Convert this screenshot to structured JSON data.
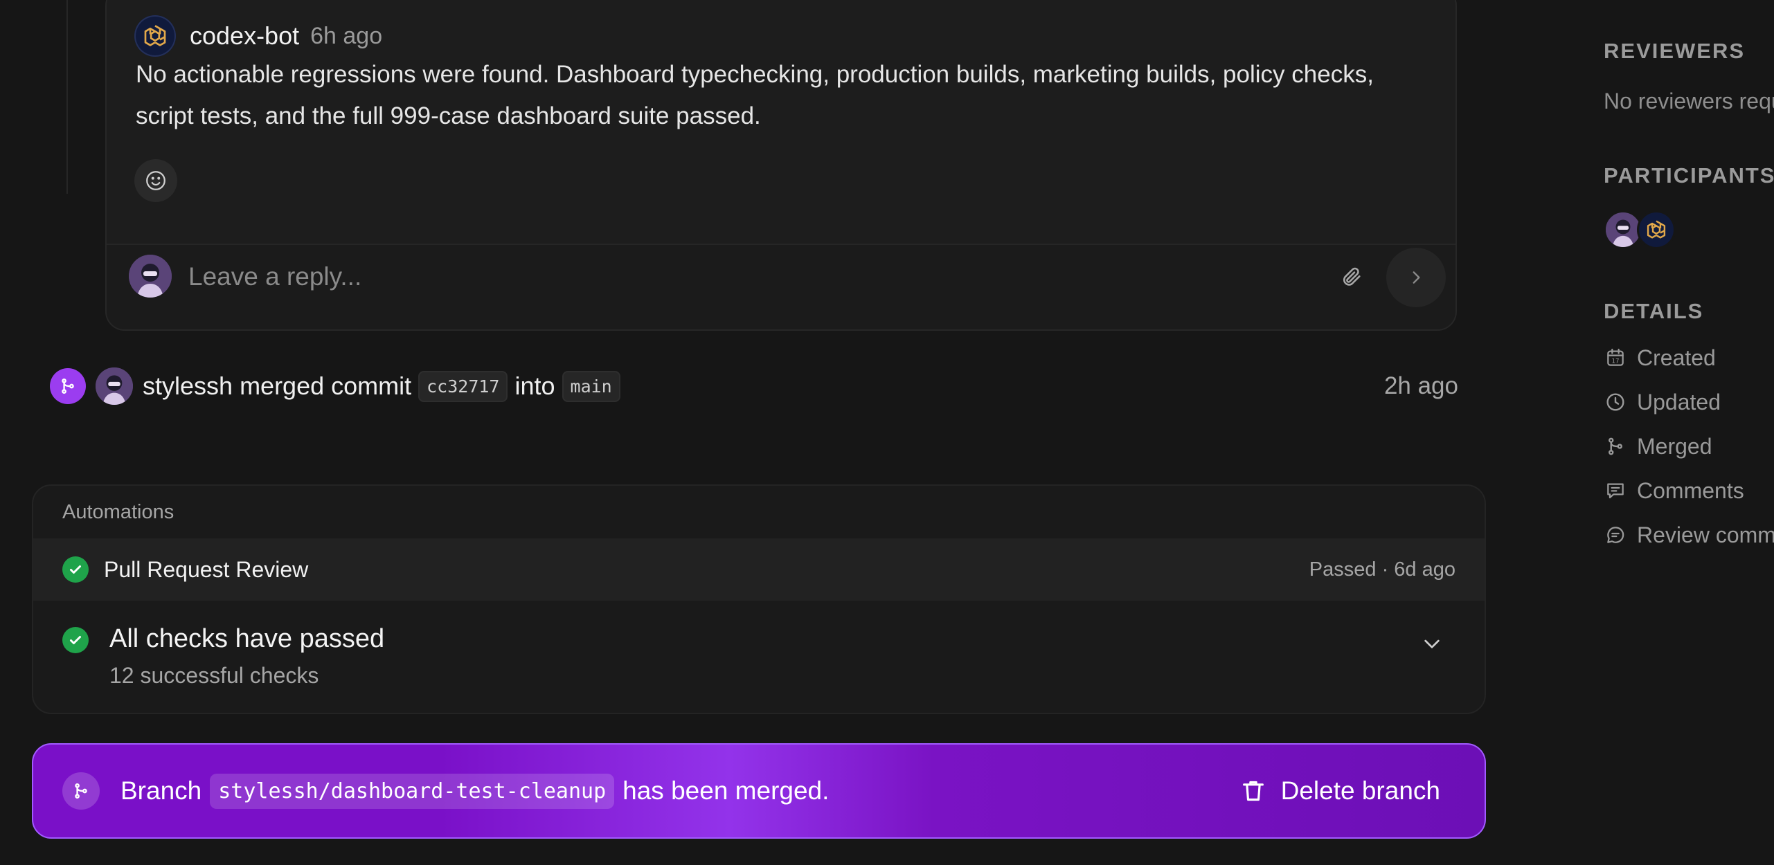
{
  "comment": {
    "author": "codex-bot",
    "time": "6h ago",
    "body": "No actionable regressions were found. Dashboard typechecking, production builds, marketing builds, policy checks, script tests, and the full 999-case dashboard suite passed.",
    "reply_placeholder": "Leave a reply..."
  },
  "merge_event": {
    "user": "stylessh",
    "verb": "merged commit",
    "commit": "cc32717",
    "into": "into",
    "branch": "main",
    "time": "2h ago"
  },
  "automations": {
    "title": "Automations",
    "review": {
      "label": "Pull Request Review",
      "status": "Passed · 6d ago"
    },
    "checks": {
      "title": "All checks have passed",
      "subtitle": "12 successful checks"
    }
  },
  "merged_banner": {
    "prefix": "Branch",
    "branch": "stylessh/dashboard-test-cleanup",
    "suffix": "has been merged.",
    "delete_label": "Delete branch"
  },
  "sidebar": {
    "reviewers_heading": "REVIEWERS",
    "reviewers_note": "No reviewers requested",
    "participants_heading": "PARTICIPANTS",
    "details_heading": "DETAILS",
    "details": [
      {
        "icon": "calendar-icon",
        "label": "Created"
      },
      {
        "icon": "clock-icon",
        "label": "Updated"
      },
      {
        "icon": "merge-icon",
        "label": "Merged"
      },
      {
        "icon": "comment-icon",
        "label": "Comments"
      },
      {
        "icon": "review-comment-icon",
        "label": "Review comments"
      }
    ]
  },
  "colors": {
    "background": "#161616",
    "merge_purple": "#9b3df0",
    "check_green": "#1fa34a",
    "banner_purple": "#7a10c8"
  }
}
